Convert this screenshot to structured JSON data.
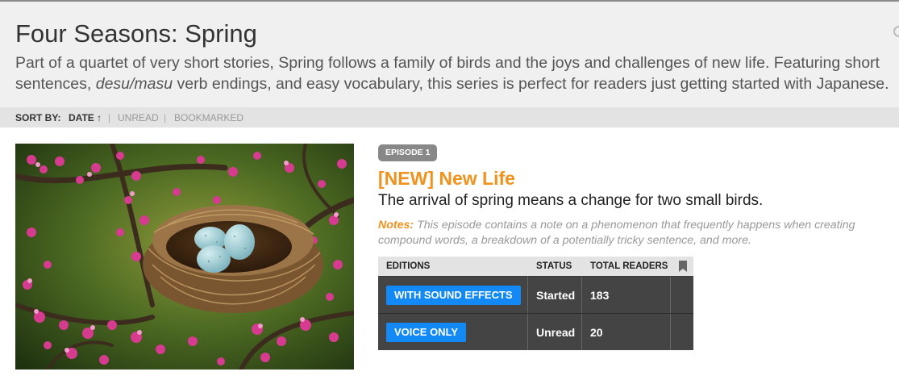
{
  "page": {
    "title": "Four Seasons: Spring",
    "description_part1": "Part of a quartet of very short stories, Spring follows a family of birds and the joys and challenges of new life. Featuring short sentences, ",
    "description_em": "desu/masu",
    "description_part2": " verb endings, and easy vocabulary, this series is perfect for readers just getting started with Japanese."
  },
  "sort": {
    "label": "SORT BY:",
    "date": "DATE ↑",
    "separator": "|",
    "unread": "UNREAD",
    "bookmarked": "BOOKMARKED"
  },
  "episode": {
    "badge": "EPISODE 1",
    "title": "[NEW] New Life",
    "subtitle": "The arrival of spring means a change for two small birds.",
    "notes_label": "Notes:",
    "notes_text": " This episode contains a note on a phenomenon that frequently happens when creating compound words, a breakdown of a potentially tricky sentence, and more.",
    "image_icon": "bird-nest-illustration"
  },
  "table": {
    "headers": {
      "editions": "EDITIONS",
      "status": "STATUS",
      "readers": "TOTAL READERS",
      "bookmark_icon": "bookmark-icon"
    },
    "rows": [
      {
        "edition": "WITH SOUND EFFECTS",
        "status": "Started",
        "readers": "183"
      },
      {
        "edition": "VOICE ONLY",
        "status": "Unread",
        "readers": "20"
      }
    ]
  },
  "colors": {
    "accent_orange": "#f0921c",
    "button_blue": "#1389f5",
    "table_dark": "#444444",
    "header_bg": "#f0f0f0"
  }
}
